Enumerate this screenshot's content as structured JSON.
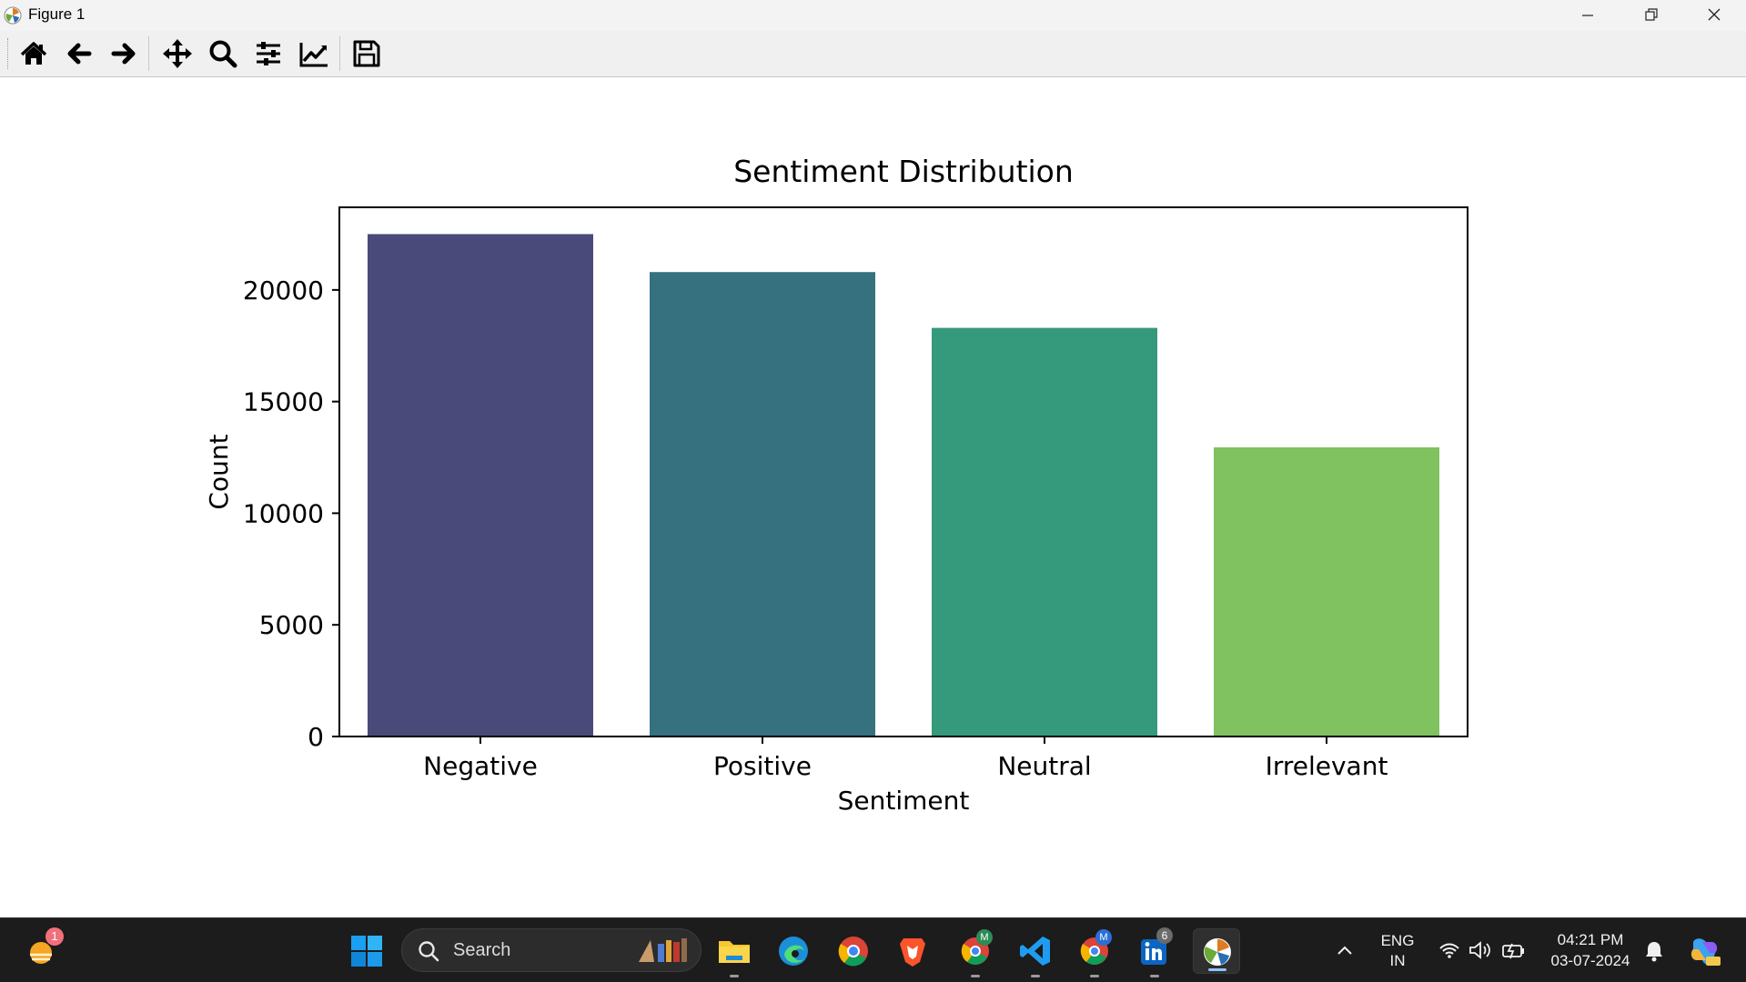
{
  "window": {
    "title": "Figure 1"
  },
  "toolbar": {
    "buttons": [
      {
        "icon": "home-icon",
        "tooltip": "Home"
      },
      {
        "icon": "back-arrow-icon",
        "tooltip": "Back"
      },
      {
        "icon": "forward-arrow-icon",
        "tooltip": "Forward"
      },
      {
        "icon": "pan-icon",
        "tooltip": "Pan"
      },
      {
        "icon": "zoom-icon",
        "tooltip": "Zoom"
      },
      {
        "icon": "subplots-icon",
        "tooltip": "Configure subplots"
      },
      {
        "icon": "axes-edit-icon",
        "tooltip": "Edit axis"
      },
      {
        "icon": "save-icon",
        "tooltip": "Save"
      }
    ]
  },
  "chart_data": {
    "type": "bar",
    "title": "Sentiment Distribution",
    "xlabel": "Sentiment",
    "ylabel": "Count",
    "categories": [
      "Negative",
      "Positive",
      "Neutral",
      "Irrelevant"
    ],
    "values": [
      22500,
      20800,
      18300,
      12950
    ],
    "colors": [
      "#4a4a7a",
      "#367180",
      "#35997b",
      "#80c160"
    ],
    "ylim": [
      0,
      23700
    ],
    "yticks": [
      0,
      5000,
      10000,
      15000,
      20000
    ],
    "ytick_labels": [
      "0",
      "5000",
      "10000",
      "15000",
      "20000"
    ],
    "grid": false,
    "legend": false
  },
  "taskbar": {
    "search_label": "Search",
    "weather_badge": "1",
    "chrome_profile_badge_1": "M",
    "chrome_profile_badge_2": "M",
    "linkedin_badge": "6",
    "language_line1": "ENG",
    "language_line2": "IN",
    "time": "04:21 PM",
    "date": "03-07-2024"
  }
}
